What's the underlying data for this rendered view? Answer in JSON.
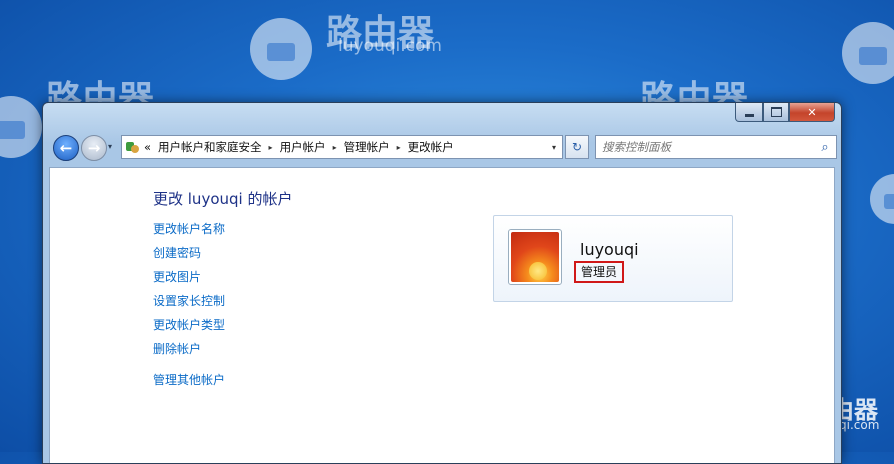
{
  "background": {
    "watermark_text": "路由器",
    "watermark_url": "luyouqi.com",
    "accent": "#1b6cc8"
  },
  "window": {
    "caption": {
      "minimize_icon": "minimize-icon",
      "maximize_icon": "maximize-icon",
      "close_icon": "close-icon",
      "close_glyph": "✕"
    },
    "toolbar": {
      "back_glyph": "←",
      "forward_glyph": "→",
      "address": {
        "overflow": "«",
        "crumbs": [
          "用户帐户和家庭安全",
          "用户帐户",
          "管理帐户",
          "更改帐户"
        ],
        "separator": "▸",
        "dropdown": "▾"
      },
      "refresh_glyph": "↻",
      "search_placeholder": "搜索控制面板",
      "search_glyph": "⌕"
    },
    "content": {
      "title": "更改 luyouqi 的帐户",
      "links": [
        "更改帐户名称",
        "创建密码",
        "更改图片",
        "设置家长控制",
        "更改帐户类型",
        "删除帐户"
      ],
      "extra_link": "管理其他帐户",
      "user": {
        "name": "luyouqi",
        "role": "管理员",
        "highlight_color": "#d01818"
      }
    }
  }
}
